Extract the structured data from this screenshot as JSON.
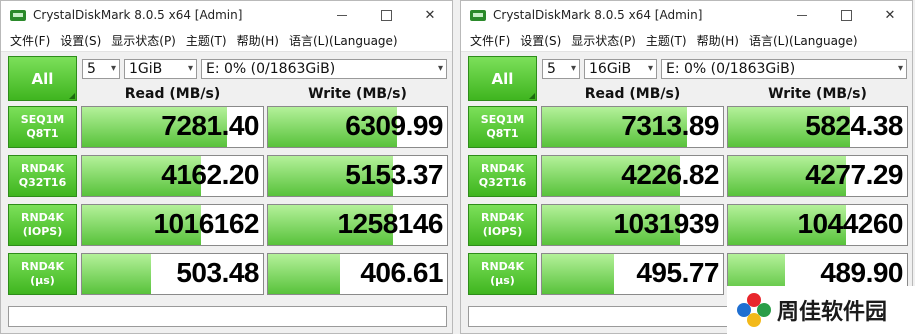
{
  "windows": [
    {
      "title": "CrystalDiskMark 8.0.5 x64 [Admin]",
      "menu": [
        "文件(F)",
        "设置(S)",
        "显示状态(P)",
        "主题(T)",
        "帮助(H)",
        "语言(L)(Language)"
      ],
      "all_label": "All",
      "count": "5",
      "size": "1GiB",
      "drive": "E: 0% (0/1863GiB)",
      "read_header": "Read (MB/s)",
      "write_header": "Write (MB/s)",
      "rows": [
        {
          "label1": "SEQ1M",
          "label2": "Q8T1",
          "read": "7281.40",
          "write": "6309.99",
          "read_fill": 0.8,
          "write_fill": 0.72
        },
        {
          "label1": "RND4K",
          "label2": "Q32T16",
          "read": "4162.20",
          "write": "5153.37",
          "read_fill": 0.66,
          "write_fill": 0.7
        },
        {
          "label1": "RND4K",
          "label2": "(IOPS)",
          "read": "1016162",
          "write": "1258146",
          "read_fill": 0.66,
          "write_fill": 0.7
        },
        {
          "label1": "RND4K",
          "label2": "(µs)",
          "read": "503.48",
          "write": "406.61",
          "read_fill": 0.38,
          "write_fill": 0.4
        }
      ]
    },
    {
      "title": "CrystalDiskMark 8.0.5 x64 [Admin]",
      "menu": [
        "文件(F)",
        "设置(S)",
        "显示状态(P)",
        "主题(T)",
        "帮助(H)",
        "语言(L)(Language)"
      ],
      "all_label": "All",
      "count": "5",
      "size": "16GiB",
      "drive": "E: 0% (0/1863GiB)",
      "read_header": "Read (MB/s)",
      "write_header": "Write (MB/s)",
      "rows": [
        {
          "label1": "SEQ1M",
          "label2": "Q8T1",
          "read": "7313.89",
          "write": "5824.38",
          "read_fill": 0.8,
          "write_fill": 0.68
        },
        {
          "label1": "RND4K",
          "label2": "Q32T16",
          "read": "4226.82",
          "write": "4277.29",
          "read_fill": 0.76,
          "write_fill": 0.66
        },
        {
          "label1": "RND4K",
          "label2": "(IOPS)",
          "read": "1031939",
          "write": "1044260",
          "read_fill": 0.76,
          "write_fill": 0.66
        },
        {
          "label1": "RND4K",
          "label2": "(µs)",
          "read": "495.77",
          "write": "489.90",
          "read_fill": 0.4,
          "write_fill": 0.32
        }
      ]
    }
  ],
  "watermark": {
    "text": "周佳软件园"
  },
  "colors": {
    "accent": "#3fb51f",
    "bar_light": "#b4f19a"
  }
}
